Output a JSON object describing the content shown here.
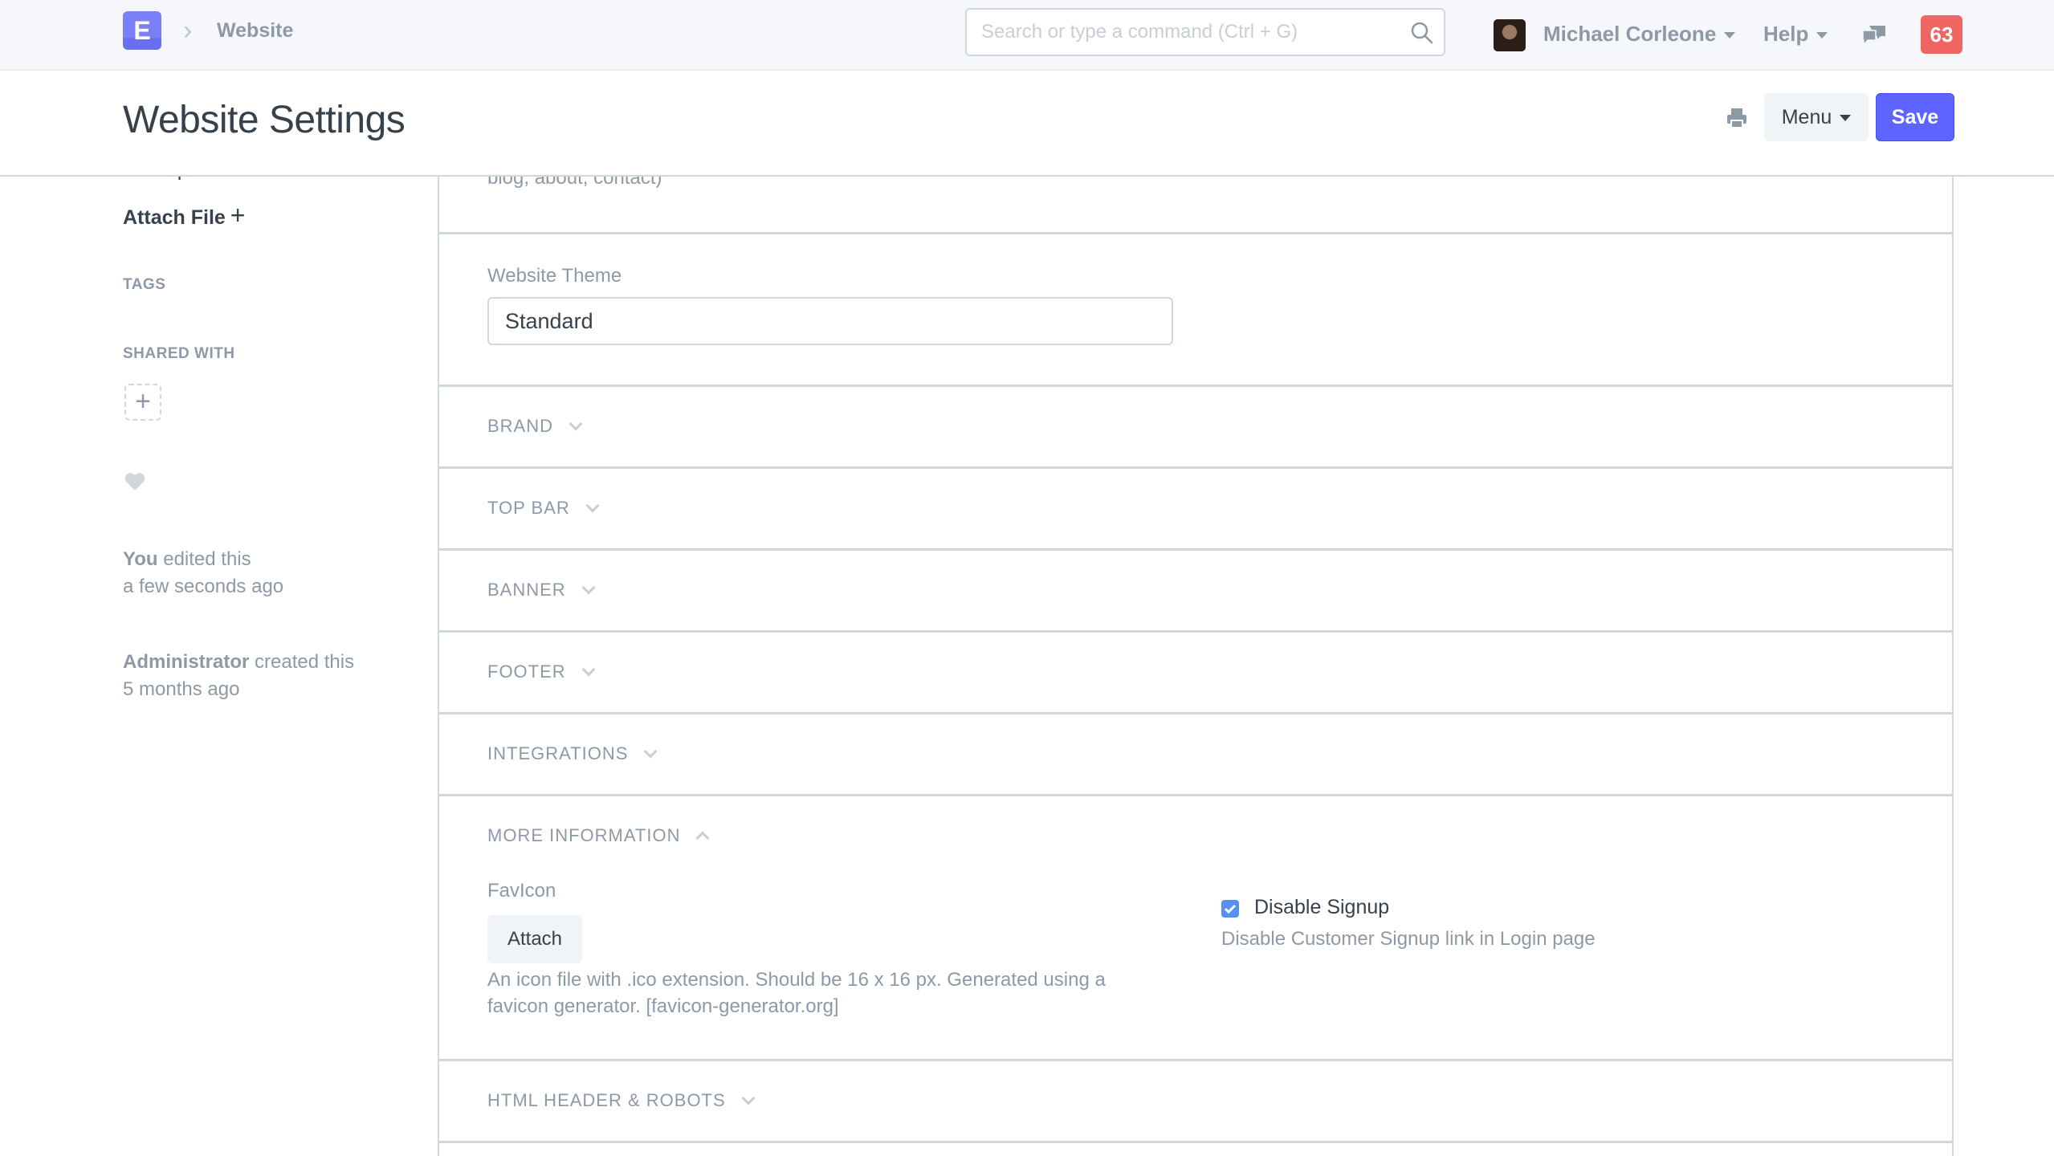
{
  "navbar": {
    "logo_letter": "E",
    "breadcrumb": "Website",
    "search_placeholder": "Search or type a command (Ctrl + G)",
    "user_name": "Michael Corleone",
    "help_label": "Help",
    "notification_count": "63"
  },
  "page_head": {
    "title": "Website Settings",
    "menu_label": "Menu",
    "save_label": "Save"
  },
  "sidebar": {
    "attachment_url": "http://site1.local:8000/fi...",
    "attach_file_label": "Attach File",
    "tags_label": "TAGS",
    "shared_with_label": "SHARED WITH",
    "timeline": [
      {
        "actor": "You",
        "action": "edited this",
        "when": "a few seconds ago"
      },
      {
        "actor": "Administrator",
        "action": "created this",
        "when": "5 months ago"
      }
    ]
  },
  "form": {
    "top_help": "blog, about, contact)",
    "website_theme_label": "Website Theme",
    "website_theme_value": "Standard",
    "sections": [
      {
        "label": "BRAND",
        "expanded": false
      },
      {
        "label": "TOP BAR",
        "expanded": false
      },
      {
        "label": "BANNER",
        "expanded": false
      },
      {
        "label": "FOOTER",
        "expanded": false
      },
      {
        "label": "INTEGRATIONS",
        "expanded": false
      },
      {
        "label": "MORE INFORMATION",
        "expanded": true
      },
      {
        "label": "HTML HEADER & ROBOTS",
        "expanded": false
      }
    ],
    "favicon_label": "FavIcon",
    "attach_button": "Attach",
    "favicon_description": "An icon file with .ico extension. Should be 16 x 16 px. Generated using a favicon generator. [favicon-generator.org]",
    "disable_signup_label": "Disable Signup",
    "disable_signup_checked": true,
    "disable_signup_description": "Disable Customer Signup link in Login page"
  },
  "colors": {
    "primary": "#5e64ff",
    "notification": "#ef6561",
    "checkbox": "#5591f5",
    "muted_text": "#8d99a6"
  }
}
